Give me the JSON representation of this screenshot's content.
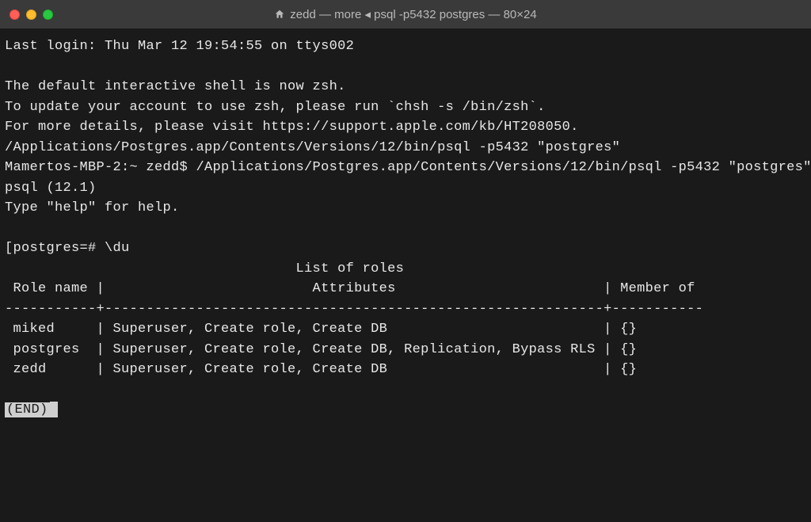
{
  "window": {
    "title": "zedd — more ◂ psql -p5432 postgres — 80×24"
  },
  "terminal": {
    "last_login": "Last login: Thu Mar 12 19:54:55 on ttys002",
    "blank1": "",
    "zsh_line1": "The default interactive shell is now zsh.",
    "zsh_line2": "To update your account to use zsh, please run `chsh -s /bin/zsh`.",
    "zsh_line3": "For more details, please visit https://support.apple.com/kb/HT208050.",
    "cmd_echo": "/Applications/Postgres.app/Contents/Versions/12/bin/psql -p5432 \"postgres\"",
    "prompt_line": "Mamertos-MBP-2:~ zedd$ /Applications/Postgres.app/Contents/Versions/12/bin/psql -p5432 \"postgres\"",
    "psql_ver": "psql (12.1)",
    "help_line": "Type \"help\" for help.",
    "blank2": "",
    "pg_prompt": "[postgres=# \\du",
    "list_title": "                                   List of roles",
    "header": " Role name |                         Attributes                         | Member of",
    "divider": "-----------+------------------------------------------------------------+-----------",
    "rows": [
      " miked     | Superuser, Create role, Create DB                          | {}",
      " postgres  | Superuser, Create role, Create DB, Replication, Bypass RLS | {}",
      " zedd      | Superuser, Create role, Create DB                          | {}"
    ],
    "blank3": "",
    "end_marker": "(END)"
  }
}
